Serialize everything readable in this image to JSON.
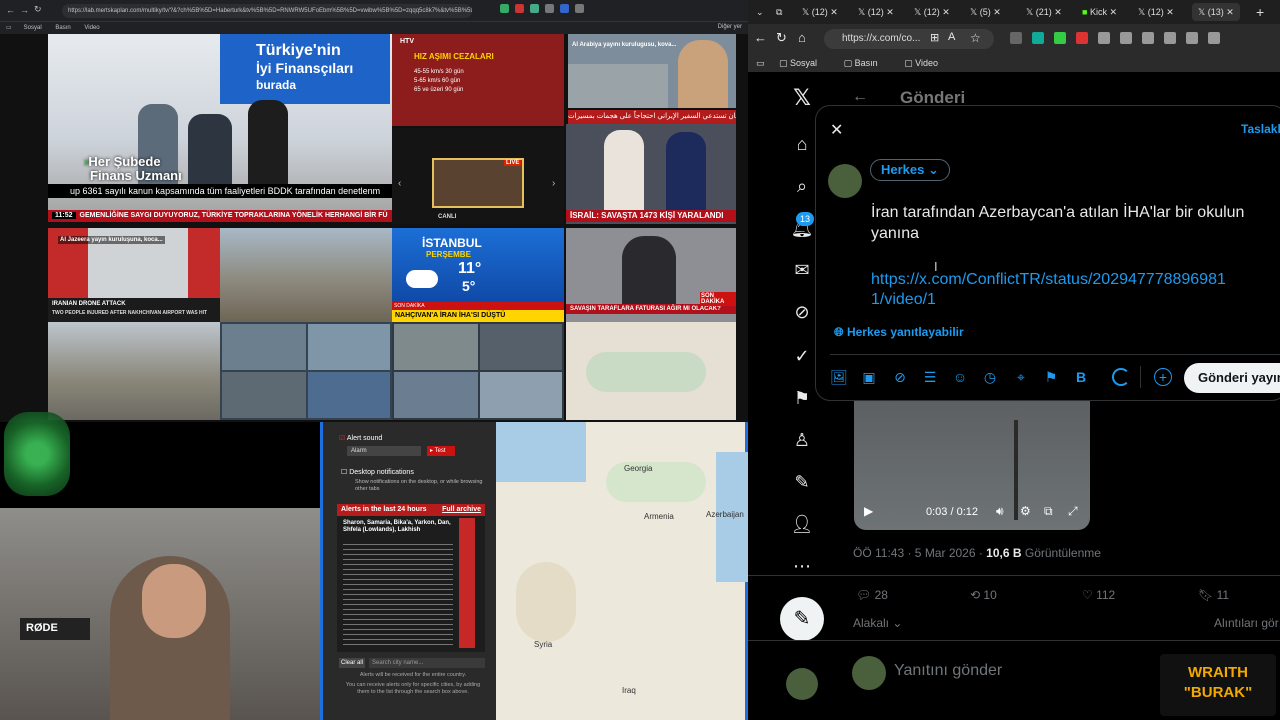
{
  "left_browser": {
    "url": "https://lab.mertskaplan.com/multiky/tv/?&?ch%5B%5D=Haberturk&tv%5B%5D=RNWRW5UFoEbm%5B%5D=vwibw%5B%5D=zqqq5c8k7%&tv%5B%5D=Al-Arabiya&tv%...",
    "bookmarks": [
      "Sosyal",
      "Basın",
      "Video"
    ],
    "bookmarks_right": "Diğer yer"
  },
  "tiles": {
    "t1_line1": "Türkiye'nin",
    "t1_line2": "İyi Finansçıları",
    "t1_line3": "burada",
    "t1_sub1": "Her Şubede",
    "t1_sub2": "Finans Uzmanı",
    "t1_ticker": "up 6361 sayılı kanun kapsamında tüm faaliyetleri BDDK tarafından denetlenm",
    "ticker2_time": "11:52",
    "ticker2": "GEMENLİĞİNE SAYGI DUYUYORUZ, TÜRKİYE TOPRAKLARINA YÖNELİK HERHANGİ BİR FÜ",
    "t2_title": "HIZ AŞIMI CEZALARI",
    "t2_brand": "HTV",
    "t2_rows": [
      "45-55 km/s   30 gün",
      "5-65 km/s    60 gün",
      "65 ve üzeri  90 gün"
    ],
    "t3_caption": "Al Arabiya yayını kurulugusu, kova...",
    "t4_live": "LIVE",
    "t4_ch": "CANLI",
    "t5_ticker": "İSRAİL: SAVAŞTA 1473 KİŞİ YARALANDI",
    "t5_top": "ناريحيان تستدعي السفير الإيراني احتجاجاً على هجمات بمسيرات",
    "t6_caption": "Al Jazeera yayın kuruluşuna, koca...",
    "t6_ticker1": "IRANIAN DRONE ATTACK",
    "t6_ticker2": "TWO PEOPLE INJURED AFTER NAKHCHIVAN AIRPORT WAS HIT",
    "weather_city": "İSTANBUL",
    "weather_day": "PERŞEMBE",
    "weather_high": "11°",
    "weather_low": "5°",
    "weather_ticker_brand": "SON DAKİKA",
    "weather_ticker": "NAHÇIVAN'A İRAN İHA'SI DÜŞTÜ",
    "t8_ticker": "SAVAŞIN TARAFLARA FATURASI AĞIR MI OLACAK?",
    "t8_brand": "SON DAKİKA"
  },
  "alerts": {
    "sound_label": "Alert sound",
    "sound_select": "Alarm",
    "test_label": "▸ Test",
    "desktop_label": "Desktop notifications",
    "desktop_desc": "Show notifications on the desktop, or while browsing other tabs",
    "header": "Alerts in the last 24 hours",
    "full_archive": "Full archive",
    "first_alert": "Sharon, Samaria, Bika'a, Yarkon, Dan, Shfela (Lowlands), Lakhish",
    "clear_all": "Clear all",
    "city_placeholder": "Search city name...",
    "footer1": "Alerts will be received for the entire country.",
    "footer2": "You can receive alerts only for specific cities, by adding them to the list through the search box above."
  },
  "map": {
    "labels": [
      "Georgia",
      "Armenia",
      "Azerbaijan",
      "Syria",
      "Iraq"
    ]
  },
  "webcam": {
    "mic_brand": "RØDE"
  },
  "right_browser": {
    "tabs": [
      "(12)",
      "(12)",
      "(12)",
      "(5)",
      "(21)",
      "Kick",
      "(12)",
      "(13)"
    ],
    "address": "https://x.com/co...",
    "bookmarks": [
      "Sosyal",
      "Basın",
      "Video"
    ]
  },
  "x": {
    "header_title": "Gönderi",
    "notif_count": "13",
    "drafts": "Taslakl",
    "audience": "Herkes",
    "tweet_text": "İran tarafından Azerbaycan'a atılan İHA'lar bir okulun yanına",
    "tweet_link_line1": "https://x.com/ConflictTR/status/202947778896981",
    "tweet_link_line2": "1/video/1",
    "reply_setting": "Herkes yanıtlayabilir",
    "post_button": "Gönderi yayın",
    "video_time": "0:03 / 0:12",
    "meta_time": "ÖÖ 11:43 · 5 Mar 2026 · ",
    "meta_views": "10,6 B",
    "meta_views_label": " Görüntülenme",
    "replies": "28",
    "reposts": "10",
    "likes": "112",
    "bookmarks": "11",
    "sort_label": "Alakalı",
    "quotes_label": "Alıntıları gör",
    "reply_placeholder": "Yanıtını gönder"
  },
  "overlay": {
    "line1": "WRAITH",
    "line2": "\"BURAK\""
  }
}
